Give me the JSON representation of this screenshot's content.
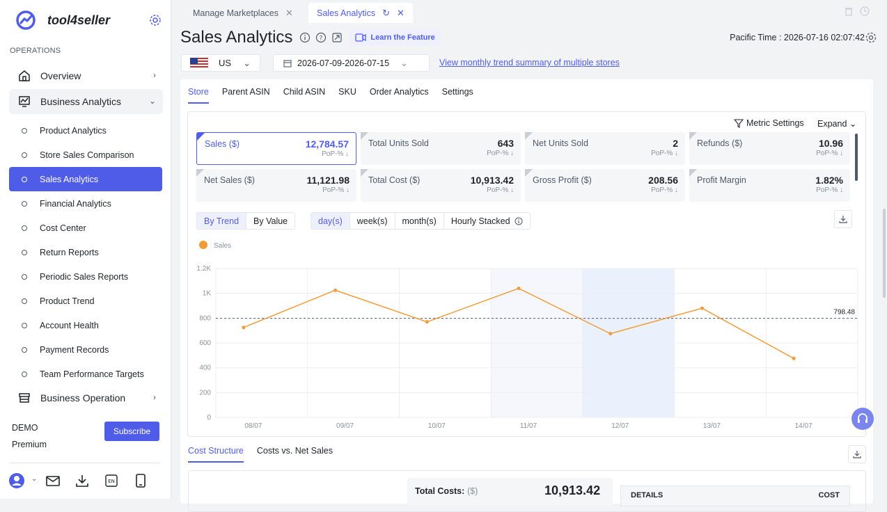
{
  "app": {
    "name": "tool4seller"
  },
  "sidebar": {
    "section": "OPERATIONS",
    "overview": "Overview",
    "business_analytics": "Business Analytics",
    "items": [
      {
        "label": "Product Analytics"
      },
      {
        "label": "Store Sales Comparison"
      },
      {
        "label": "Sales Analytics",
        "active": true
      },
      {
        "label": "Financial Analytics"
      },
      {
        "label": "Cost Center"
      },
      {
        "label": "Return Reports"
      },
      {
        "label": "Periodic Sales Reports"
      },
      {
        "label": "Product Trend"
      },
      {
        "label": "Account Health"
      },
      {
        "label": "Payment Records"
      },
      {
        "label": "Team Performance Targets"
      }
    ],
    "business_operation": "Business Operation",
    "plan_user": "DEMO",
    "plan_name": "Premium",
    "subscribe": "Subscribe"
  },
  "tabs": [
    {
      "label": "Manage Marketplaces"
    },
    {
      "label": "Sales Analytics",
      "active": true
    }
  ],
  "header": {
    "title": "Sales Analytics",
    "learn": "Learn the Feature",
    "pacific": "Pacific Time :  2026-07-16 02:07:42",
    "country": "US",
    "date_range": "2026-07-09-2026-07-15",
    "trend_link": "View monthly trend summary of multiple stores"
  },
  "subtabs": [
    "Store",
    "Parent ASIN",
    "Child ASIN",
    "SKU",
    "Order Analytics",
    "Settings"
  ],
  "metric_settings": "Metric Settings",
  "expand": "Expand",
  "metrics": [
    {
      "label": "Sales ($)",
      "value": "12,784.57",
      "pop": "PoP-%",
      "selected": true
    },
    {
      "label": "Total Units Sold",
      "value": "643",
      "pop": "PoP-%"
    },
    {
      "label": "Net Units Sold",
      "value": "2",
      "pop": "PoP-%"
    },
    {
      "label": "Refunds ($)",
      "value": "10.96",
      "pop": "PoP-%"
    },
    {
      "label": "Net Sales ($)",
      "value": "11,121.98",
      "pop": "PoP-%"
    },
    {
      "label": "Total Cost ($)",
      "value": "10,913.42",
      "pop": "PoP-%"
    },
    {
      "label": "Gross Profit ($)",
      "value": "208.56",
      "pop": "PoP-%"
    },
    {
      "label": "Profit Margin",
      "value": "1.82%",
      "pop": "PoP-%"
    }
  ],
  "view_toggle": [
    "By Trend",
    "By Value"
  ],
  "period_toggle": [
    "day(s)",
    "week(s)",
    "month(s)",
    "Hourly Stacked"
  ],
  "chart_data": {
    "type": "line",
    "legend": "Sales",
    "categories": [
      "08/07",
      "09/07",
      "10/07",
      "11/07",
      "12/07",
      "13/07",
      "14/07"
    ],
    "series": [
      {
        "name": "Sales",
        "values": [
          725,
          1025,
          770,
          1040,
          675,
          880,
          475
        ]
      }
    ],
    "ylim": [
      0,
      1200
    ],
    "yticks": [
      "0",
      "200",
      "400",
      "600",
      "800",
      "1K",
      "1.2K"
    ],
    "average": 798.48,
    "average_label": "798.48",
    "color": "#f29b38"
  },
  "cost": {
    "tabs": [
      "Cost Structure",
      "Costs vs. Net Sales"
    ],
    "total_label": "Total Costs:",
    "total_unit": "($)",
    "total_value": "10,913.42",
    "details": "DETAILS",
    "cost_col": "COST"
  }
}
